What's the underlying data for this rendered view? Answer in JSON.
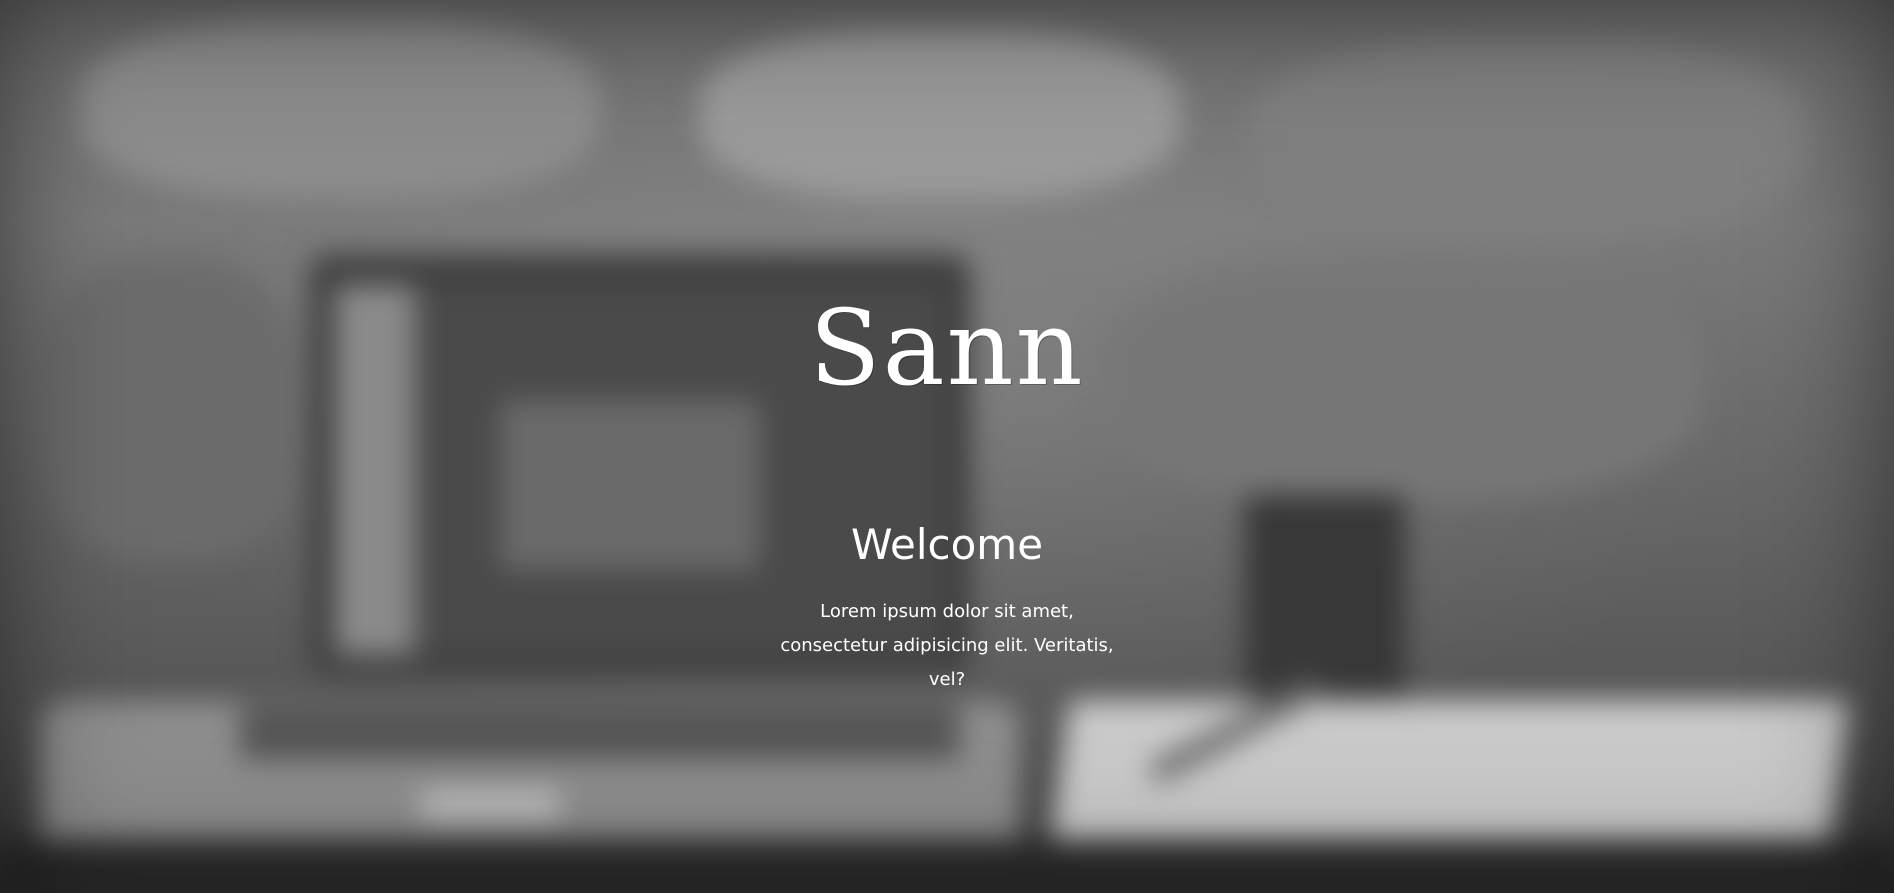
{
  "hero": {
    "logo": "Sann",
    "title": "Welcome",
    "description": "Lorem ipsum dolor sit amet, consectetur adipisicing elit. Veritatis, vel?"
  },
  "colors": {
    "text": "#ffffff",
    "background": "#6b6b6b"
  }
}
